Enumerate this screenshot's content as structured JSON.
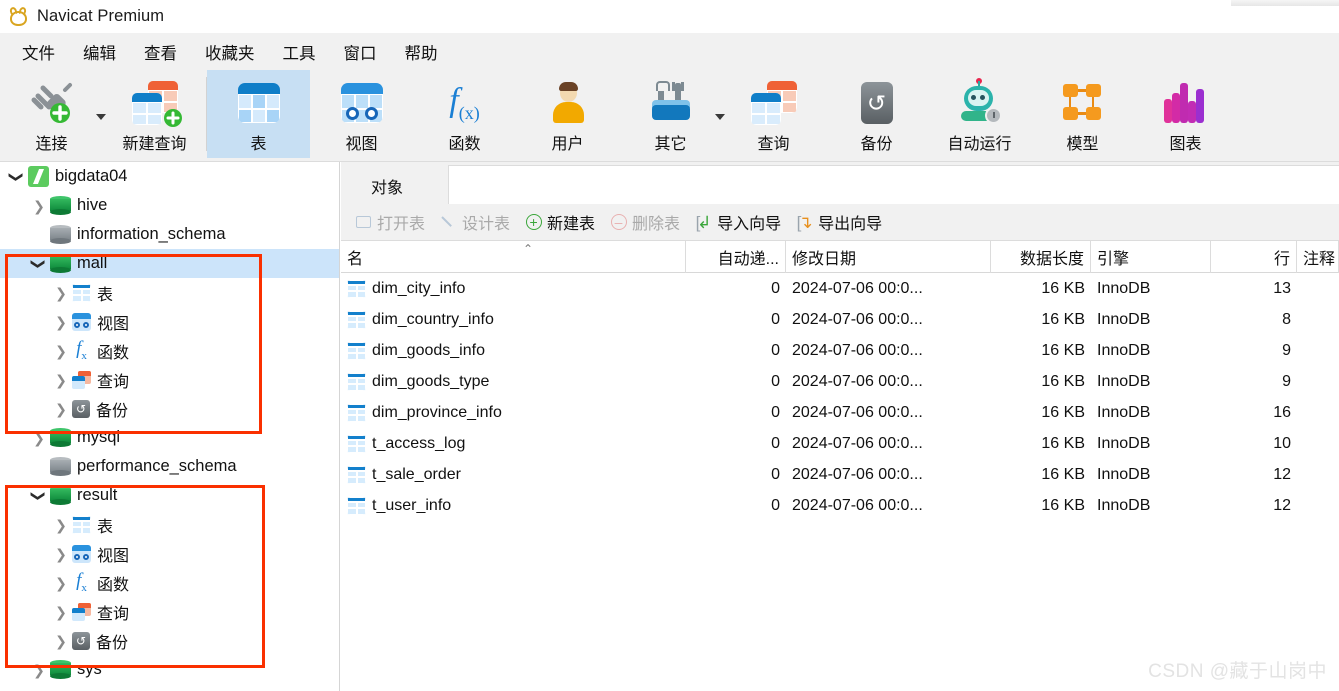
{
  "window": {
    "title": "Navicat Premium",
    "logo_icon": "navicat-logo-icon"
  },
  "menubar": {
    "items": [
      {
        "label": "文件",
        "name": "menu-file"
      },
      {
        "label": "编辑",
        "name": "menu-edit"
      },
      {
        "label": "查看",
        "name": "menu-view"
      },
      {
        "label": "收藏夹",
        "name": "menu-favorites"
      },
      {
        "label": "工具",
        "name": "menu-tools"
      },
      {
        "label": "窗口",
        "name": "menu-window"
      },
      {
        "label": "帮助",
        "name": "menu-help"
      }
    ]
  },
  "ribbon": {
    "items": [
      {
        "label": "连接",
        "icon": "connection-icon",
        "has_dropdown": true,
        "selected": false
      },
      {
        "label": "新建查询",
        "icon": "new-query-icon",
        "has_dropdown": false,
        "selected": false
      },
      {
        "label": "表",
        "icon": "table-icon",
        "has_dropdown": false,
        "selected": true
      },
      {
        "label": "视图",
        "icon": "view-icon",
        "has_dropdown": false,
        "selected": false
      },
      {
        "label": "函数",
        "icon": "function-icon",
        "has_dropdown": false,
        "selected": false
      },
      {
        "label": "用户",
        "icon": "user-icon",
        "has_dropdown": false,
        "selected": false
      },
      {
        "label": "其它",
        "icon": "other-tools-icon",
        "has_dropdown": true,
        "selected": false
      },
      {
        "label": "查询",
        "icon": "query-icon",
        "has_dropdown": false,
        "selected": false
      },
      {
        "label": "备份",
        "icon": "backup-icon",
        "has_dropdown": false,
        "selected": false
      },
      {
        "label": "自动运行",
        "icon": "automation-robot-icon",
        "has_dropdown": false,
        "selected": false
      },
      {
        "label": "模型",
        "icon": "model-icon",
        "has_dropdown": false,
        "selected": false
      },
      {
        "label": "图表",
        "icon": "chart-icon",
        "has_dropdown": false,
        "selected": false
      }
    ]
  },
  "sidebar": {
    "tree": [
      {
        "label": "bigdata04",
        "icon": "connection-mysql-icon",
        "indent": 0,
        "expander": "down",
        "selected": false
      },
      {
        "label": "hive",
        "icon": "database-green-icon",
        "indent": 1,
        "expander": "right",
        "selected": false
      },
      {
        "label": "information_schema",
        "icon": "database-grey-icon",
        "indent": 1,
        "expander": "none",
        "selected": false
      },
      {
        "label": "mall",
        "icon": "database-green-icon",
        "indent": 1,
        "expander": "down",
        "selected": true
      },
      {
        "label": "表",
        "icon": "table-icon",
        "indent": 2,
        "expander": "right",
        "selected": false
      },
      {
        "label": "视图",
        "icon": "view-icon",
        "indent": 2,
        "expander": "right",
        "selected": false
      },
      {
        "label": "函数",
        "icon": "function-icon",
        "indent": 2,
        "expander": "right",
        "selected": false
      },
      {
        "label": "查询",
        "icon": "query-icon",
        "indent": 2,
        "expander": "right",
        "selected": false
      },
      {
        "label": "备份",
        "icon": "backup-icon",
        "indent": 2,
        "expander": "right",
        "selected": false
      },
      {
        "label": "mysql",
        "icon": "database-green-icon",
        "indent": 1,
        "expander": "right",
        "selected": false
      },
      {
        "label": "performance_schema",
        "icon": "database-grey-icon",
        "indent": 1,
        "expander": "none",
        "selected": false
      },
      {
        "label": "result",
        "icon": "database-green-icon",
        "indent": 1,
        "expander": "down",
        "selected": false
      },
      {
        "label": "表",
        "icon": "table-icon",
        "indent": 2,
        "expander": "right",
        "selected": false
      },
      {
        "label": "视图",
        "icon": "view-icon",
        "indent": 2,
        "expander": "right",
        "selected": false
      },
      {
        "label": "函数",
        "icon": "function-icon",
        "indent": 2,
        "expander": "right",
        "selected": false
      },
      {
        "label": "查询",
        "icon": "query-icon",
        "indent": 2,
        "expander": "right",
        "selected": false
      },
      {
        "label": "备份",
        "icon": "backup-icon",
        "indent": 2,
        "expander": "right",
        "selected": false
      },
      {
        "label": "sys",
        "icon": "database-green-icon",
        "indent": 1,
        "expander": "right",
        "selected": false
      }
    ],
    "annotation_color": "#fa3000",
    "selection_color": "#cce4fa"
  },
  "tabs": {
    "object_tab": "对象"
  },
  "objectbar": {
    "buttons": [
      {
        "label": "打开表",
        "icon": "open-table-icon",
        "enabled": false
      },
      {
        "label": "设计表",
        "icon": "design-table-icon",
        "enabled": false
      },
      {
        "label": "新建表",
        "icon": "new-table-plus-icon",
        "enabled": true
      },
      {
        "label": "删除表",
        "icon": "delete-table-minus-icon",
        "enabled": false
      },
      {
        "label": "导入向导",
        "icon": "import-wizard-icon",
        "enabled": true
      },
      {
        "label": "导出向导",
        "icon": "export-wizard-icon",
        "enabled": true
      }
    ]
  },
  "grid": {
    "columns": [
      "名",
      "自动递...",
      "修改日期",
      "数据长度",
      "引擎",
      "行",
      "注释"
    ],
    "sort_indicator": "ascending",
    "rows": [
      {
        "name": "dim_city_info",
        "auto_increment": "0",
        "modified": "2024-07-06 00:0...",
        "data_length": "16 KB",
        "engine": "InnoDB",
        "rows": "13",
        "comment": ""
      },
      {
        "name": "dim_country_info",
        "auto_increment": "0",
        "modified": "2024-07-06 00:0...",
        "data_length": "16 KB",
        "engine": "InnoDB",
        "rows": "8",
        "comment": ""
      },
      {
        "name": "dim_goods_info",
        "auto_increment": "0",
        "modified": "2024-07-06 00:0...",
        "data_length": "16 KB",
        "engine": "InnoDB",
        "rows": "9",
        "comment": ""
      },
      {
        "name": "dim_goods_type",
        "auto_increment": "0",
        "modified": "2024-07-06 00:0...",
        "data_length": "16 KB",
        "engine": "InnoDB",
        "rows": "9",
        "comment": ""
      },
      {
        "name": "dim_province_info",
        "auto_increment": "0",
        "modified": "2024-07-06 00:0...",
        "data_length": "16 KB",
        "engine": "InnoDB",
        "rows": "16",
        "comment": ""
      },
      {
        "name": "t_access_log",
        "auto_increment": "0",
        "modified": "2024-07-06 00:0...",
        "data_length": "16 KB",
        "engine": "InnoDB",
        "rows": "10",
        "comment": ""
      },
      {
        "name": "t_sale_order",
        "auto_increment": "0",
        "modified": "2024-07-06 00:0...",
        "data_length": "16 KB",
        "engine": "InnoDB",
        "rows": "12",
        "comment": ""
      },
      {
        "name": "t_user_info",
        "auto_increment": "0",
        "modified": "2024-07-06 00:0...",
        "data_length": "16 KB",
        "engine": "InnoDB",
        "rows": "12",
        "comment": ""
      }
    ]
  },
  "watermark": "CSDN @藏于山岗中"
}
